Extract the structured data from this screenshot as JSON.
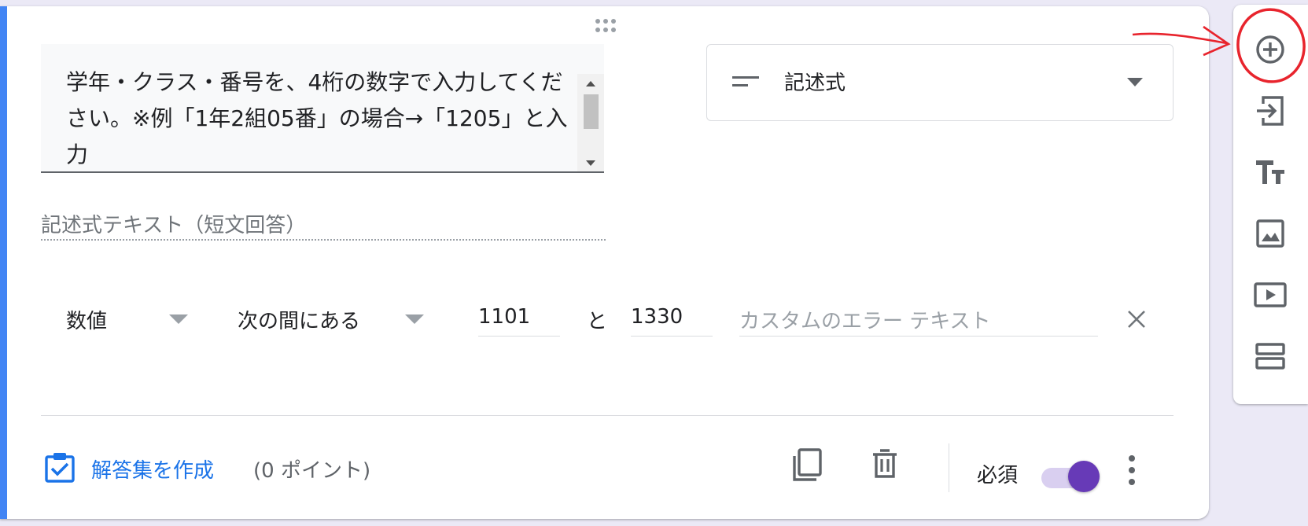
{
  "question": {
    "text": "学年・クラス・番号を、4桁の数字で入力してください。※例「1年2組05番」の場合→「1205」と入力",
    "type_label": "記述式"
  },
  "answer": {
    "placeholder": "記述式テキスト（短文回答）"
  },
  "validation": {
    "type": "数値",
    "condition": "次の間にある",
    "min": "1101",
    "and": "と",
    "max": "1330",
    "error_placeholder": "カスタムのエラー テキスト"
  },
  "footer": {
    "answer_key": "解答集を作成",
    "points": "(0 ポイント)",
    "required": "必須",
    "required_on": true
  },
  "colors": {
    "accent": "#4285f4",
    "link": "#1a73e8",
    "toggle": "#673ab7",
    "annotation": "#e8242d"
  },
  "toolbar": {
    "items": [
      "add-question-icon",
      "import-questions-icon",
      "add-title-icon",
      "add-image-icon",
      "add-video-icon",
      "add-section-icon"
    ]
  }
}
